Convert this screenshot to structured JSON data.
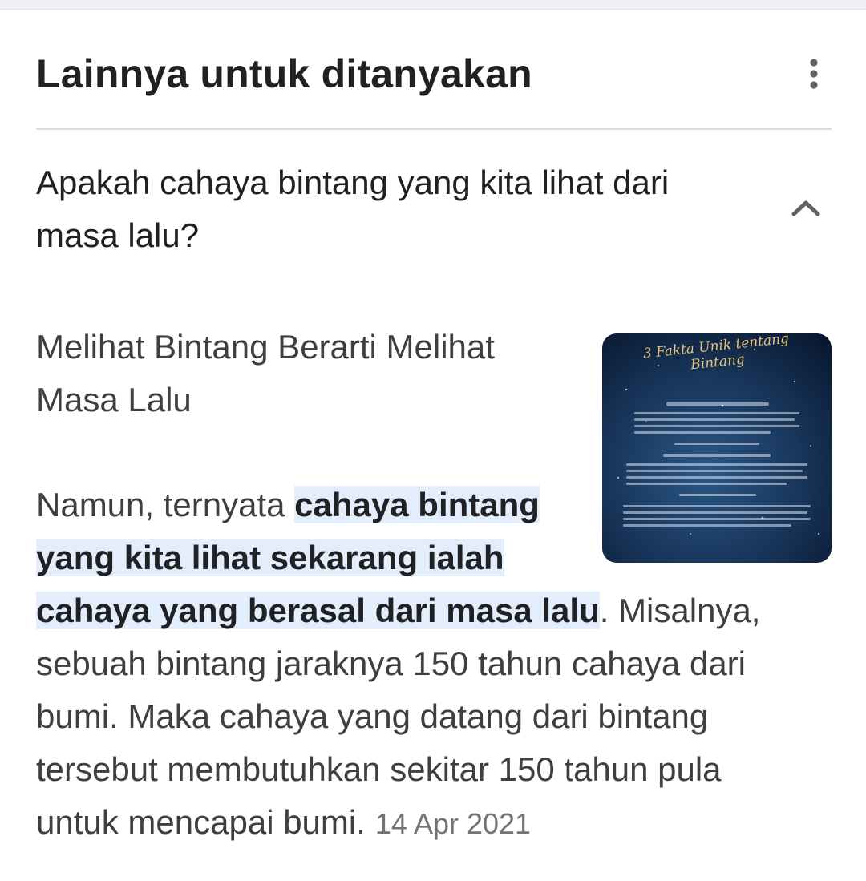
{
  "header": {
    "title": "Lainnya untuk ditanyakan",
    "more_icon": "more-vert-icon"
  },
  "question": {
    "text": "Apakah cahaya bintang yang kita lihat dari masa lalu?",
    "expand_icon": "chevron-up-icon",
    "expanded": true
  },
  "answer": {
    "heading_line1": "Melihat Bintang Berarti Melihat",
    "heading_line2": "Masa Lalu",
    "intro": "Namun, ternyata ",
    "highlight_line1": "cahaya bintang",
    "highlight_line2": "yang kita lihat sekarang ialah",
    "highlight_line3": "cahaya yang berasal dari masa lalu",
    "rest_line3": ". Misalnya,",
    "line4": "sebuah bintang jaraknya 150 tahun cahaya dari",
    "line5": "bumi. Maka cahaya yang datang dari bintang",
    "line6": "tersebut membutuhkan sekitar 150 tahun pula",
    "line7": "untuk mencapai bumi.",
    "date": "14 Apr 2021"
  },
  "thumbnail": {
    "title_line1": "3 Fakta Unik tentang",
    "title_line2": "Bintang",
    "colors": {
      "bg_dark": "#0b1a33",
      "bg_mid": "#1d3c66",
      "title": "#e8c27a"
    }
  },
  "colors": {
    "title_text": "#202124",
    "body_text": "#3c4043",
    "highlight_bg": "#e3edfb",
    "divider": "#dadce0",
    "date_text": "#70757a"
  }
}
